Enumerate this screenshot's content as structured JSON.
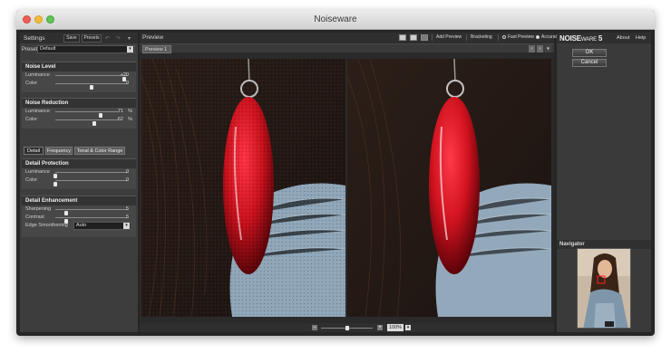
{
  "window": {
    "title": "Noiseware"
  },
  "settings": {
    "title": "Settings",
    "save_label": "Save",
    "presets_label": "Presets",
    "preset_label": "Preset",
    "preset_value": "Default",
    "noise_level": {
      "title": "Noise Level",
      "sliders": [
        {
          "name": "Luminance",
          "value": "+20",
          "level": 0.95
        },
        {
          "name": "Color",
          "value": "0",
          "level": 0.5
        }
      ]
    },
    "noise_reduction": {
      "title": "Noise Reduction",
      "sliders": [
        {
          "name": "Luminance",
          "value": "71",
          "unit": "%",
          "level": 0.71
        },
        {
          "name": "Color",
          "value": "62",
          "unit": "%",
          "level": 0.62
        }
      ]
    },
    "tabs": [
      "Detail",
      "Frequency",
      "Tonal & Color Range"
    ],
    "detail_protection": {
      "title": "Detail Protection",
      "sliders": [
        {
          "name": "Luminance",
          "value": "0",
          "level": 0.0
        },
        {
          "name": "Color",
          "value": "0",
          "level": 0.0
        }
      ]
    },
    "detail_enhancement": {
      "title": "Detail Enhancement",
      "sliders": [
        {
          "name": "Sharpening",
          "value": "5",
          "level": 0.15
        },
        {
          "name": "Contrast",
          "value": "5",
          "level": 0.15
        }
      ],
      "edge_smoothening_label": "Edge Smoothening",
      "edge_smoothening_value": "Auto"
    }
  },
  "preview": {
    "title": "Preview",
    "add_preview_label": "Add Preview",
    "bracketing_label": "Bracketing",
    "fast_preview_label": "Fast Preview",
    "accurate_label": "Accurate",
    "tab_label": "Preview 1",
    "zoom_value": "100%",
    "zoom_level": 0.5
  },
  "product": {
    "logo_main": "NOISE",
    "logo_small": "WARE",
    "version": "5"
  },
  "right": {
    "about_label": "About",
    "help_label": "Help",
    "ok_label": "OK",
    "cancel_label": "Cancel",
    "navigator_title": "Navigator"
  },
  "colors": {
    "panel": "#3d3d3d",
    "earring_red": "#c8101c",
    "denim": "#8fa6b8"
  }
}
